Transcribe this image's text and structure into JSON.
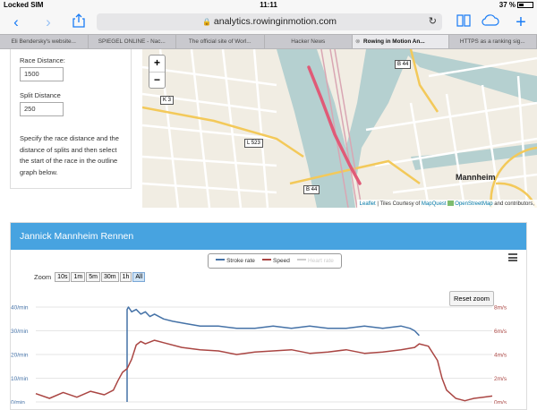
{
  "status": {
    "carrier": "Locked SIM",
    "time": "11:11",
    "battery": "37 %"
  },
  "browser": {
    "url": "analytics.rowinginmotion.com",
    "tabs": [
      {
        "label": "Eli Bendersky's website..."
      },
      {
        "label": "SPIEGEL ONLINE - Nac..."
      },
      {
        "label": "The official site of Worl..."
      },
      {
        "label": "Hacker News"
      },
      {
        "label": "Rowing in Motion An...",
        "active": true
      },
      {
        "label": "HTTPS as a ranking sig..."
      }
    ]
  },
  "panel": {
    "race_distance_label": "Race Distance:",
    "race_distance_value": "1500",
    "split_distance_label": "Split Distance",
    "split_distance_value": "250",
    "description": "Specify the race distance and the distance of splits and then select the start of the race in the outline graph below."
  },
  "map": {
    "zoom_in": "+",
    "zoom_out": "−",
    "labels": {
      "b44_top": "B 44",
      "k3": "K 3",
      "l523": "L 523",
      "b44_bottom": "B 44",
      "city": "Mannheim"
    },
    "attribution": {
      "leaflet": "Leaflet",
      "tiles": " | Tiles Courtesy of ",
      "mapquest": "MapQuest",
      "osm": "OpenStreetMap",
      "contrib": " and contributors,"
    }
  },
  "chart_card": {
    "title": "Jannick Mannheim Rennen",
    "zoom_label": "Zoom",
    "zoom_buttons": [
      "10s",
      "1m",
      "5m",
      "30m",
      "1h",
      "All"
    ],
    "zoom_selected": "All",
    "reset_zoom": "Reset zoom",
    "colors": {
      "stroke": "#4572a7",
      "speed": "#aa4643",
      "heart": "#cccccc",
      "header": "#47a3e0"
    }
  },
  "chart_data": {
    "type": "line",
    "legend": [
      "Stroke rate",
      "Speed",
      "Heart rate"
    ],
    "y_left": {
      "ticks": [
        "40/min",
        "30/min",
        "20/min",
        "10/min",
        "0/min"
      ],
      "range": [
        0,
        40
      ]
    },
    "y_right": {
      "ticks": [
        "8m/s",
        "6m/s",
        "4m/s",
        "2m/s",
        "0m/s"
      ],
      "range": [
        0,
        8
      ]
    },
    "x_range": [
      0,
      100
    ],
    "series": [
      {
        "name": "Stroke rate",
        "color": "#4572a7",
        "x": [
          20,
          20,
          20.3,
          21,
          22,
          23,
          24,
          25,
          26,
          28,
          30,
          33,
          36,
          40,
          44,
          48,
          52,
          56,
          60,
          64,
          68,
          72,
          76,
          80,
          82,
          83,
          84
        ],
        "y": [
          0,
          39,
          40,
          38,
          39,
          37,
          38,
          36,
          37,
          35,
          34,
          33,
          32,
          32,
          31,
          31,
          32,
          31,
          32,
          31,
          31,
          32,
          31,
          32,
          31,
          30,
          28
        ]
      },
      {
        "name": "Speed",
        "color": "#aa4643",
        "x": [
          0,
          3,
          6,
          9,
          12,
          15,
          17,
          18,
          19,
          20,
          21,
          22,
          23,
          24,
          26,
          28,
          32,
          36,
          40,
          44,
          48,
          52,
          56,
          60,
          64,
          68,
          72,
          76,
          80,
          83,
          84,
          86,
          88,
          89,
          90,
          92,
          93,
          94,
          95,
          96,
          98,
          100
        ],
        "y": [
          0.7,
          0.3,
          0.8,
          0.4,
          0.9,
          0.6,
          1.0,
          1.8,
          2.5,
          2.8,
          3.6,
          4.8,
          5.1,
          4.9,
          5.2,
          5.0,
          4.6,
          4.4,
          4.3,
          4.0,
          4.2,
          4.3,
          4.4,
          4.1,
          4.2,
          4.4,
          4.1,
          4.2,
          4.4,
          4.6,
          4.9,
          4.7,
          3.5,
          2.0,
          1.0,
          0.3,
          0.2,
          0.1,
          0.2,
          0.3,
          0.4,
          0.5
        ]
      }
    ]
  }
}
